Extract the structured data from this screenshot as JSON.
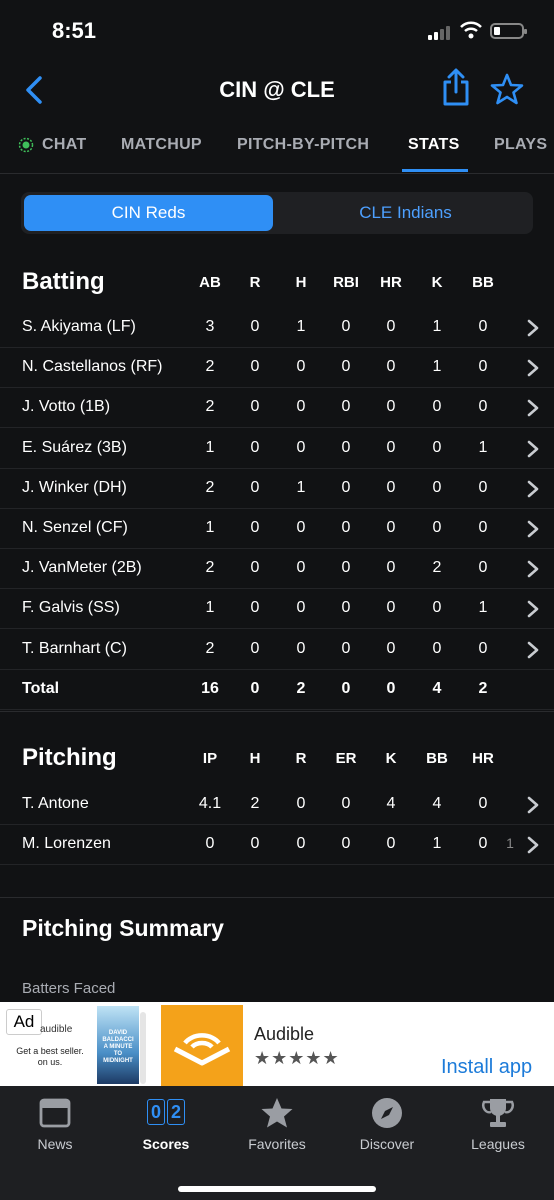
{
  "status_bar": {
    "time": "8:51"
  },
  "nav": {
    "title": "CIN @ CLE"
  },
  "tabs": [
    {
      "label": "CHAT"
    },
    {
      "label": "MATCHUP"
    },
    {
      "label": "PITCH-BY-PITCH"
    },
    {
      "label": "STATS"
    },
    {
      "label": "PLAYS"
    }
  ],
  "segment": {
    "left": "CIN Reds",
    "right": "CLE Indians"
  },
  "batting": {
    "title": "Batting",
    "headers": [
      "AB",
      "R",
      "H",
      "RBI",
      "HR",
      "K",
      "BB"
    ],
    "rows": [
      {
        "name": "S. Akiyama (LF)",
        "stats": [
          "3",
          "0",
          "1",
          "0",
          "0",
          "1",
          "0"
        ]
      },
      {
        "name": "N. Castellanos (RF)",
        "stats": [
          "2",
          "0",
          "0",
          "0",
          "0",
          "1",
          "0"
        ]
      },
      {
        "name": "J. Votto (1B)",
        "stats": [
          "2",
          "0",
          "0",
          "0",
          "0",
          "0",
          "0"
        ]
      },
      {
        "name": "E. Suárez (3B)",
        "stats": [
          "1",
          "0",
          "0",
          "0",
          "0",
          "0",
          "1"
        ]
      },
      {
        "name": "J. Winker (DH)",
        "stats": [
          "2",
          "0",
          "1",
          "0",
          "0",
          "0",
          "0"
        ]
      },
      {
        "name": "N. Senzel (CF)",
        "stats": [
          "1",
          "0",
          "0",
          "0",
          "0",
          "0",
          "0"
        ]
      },
      {
        "name": "J. VanMeter (2B)",
        "stats": [
          "2",
          "0",
          "0",
          "0",
          "0",
          "2",
          "0"
        ]
      },
      {
        "name": "F. Galvis (SS)",
        "stats": [
          "1",
          "0",
          "0",
          "0",
          "0",
          "0",
          "1"
        ]
      },
      {
        "name": "T. Barnhart (C)",
        "stats": [
          "2",
          "0",
          "0",
          "0",
          "0",
          "0",
          "0"
        ]
      }
    ],
    "total": {
      "name": "Total",
      "stats": [
        "16",
        "0",
        "2",
        "0",
        "0",
        "4",
        "2"
      ]
    }
  },
  "pitching": {
    "title": "Pitching",
    "headers": [
      "IP",
      "H",
      "R",
      "ER",
      "K",
      "BB",
      "HR"
    ],
    "rows": [
      {
        "name": "T. Antone",
        "stats": [
          "4.1",
          "2",
          "0",
          "0",
          "4",
          "4",
          "0"
        ]
      },
      {
        "name": "M. Lorenzen",
        "stats": [
          "0",
          "0",
          "0",
          "0",
          "0",
          "1",
          "0"
        ],
        "extra": "1"
      }
    ]
  },
  "summary": {
    "title": "Pitching Summary",
    "subtitle": "Batters Faced"
  },
  "ad": {
    "label": "Ad",
    "mini_brand": "audible",
    "small_text": "Get a best seller. on us.",
    "book_text": "DAVID BALDACCI A MINUTE TO MIDNIGHT",
    "app_name": "Audible",
    "stars": "★★★★★",
    "install": "Install app"
  },
  "bottom_nav": [
    {
      "label": "News",
      "icon": "news-icon"
    },
    {
      "label": "Scores",
      "icon": "scores-icon",
      "score_left": "0",
      "score_right": "2"
    },
    {
      "label": "Favorites",
      "icon": "star-icon"
    },
    {
      "label": "Discover",
      "icon": "compass-icon"
    },
    {
      "label": "Leagues",
      "icon": "trophy-icon"
    }
  ],
  "colors": {
    "accent": "#2f8ff5",
    "background": "#111214",
    "chat_dot": "#3fbf5a",
    "ad_logo": "#f4a21a"
  }
}
